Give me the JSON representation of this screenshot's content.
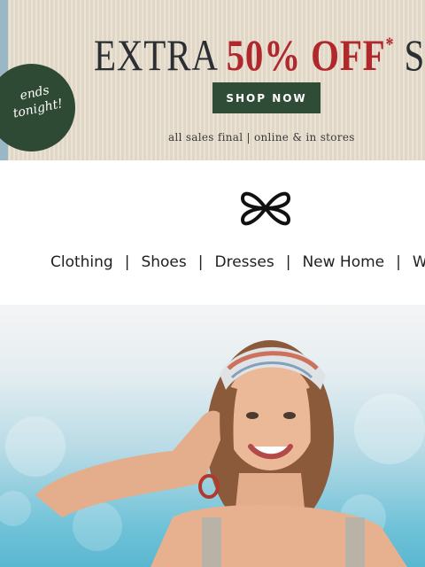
{
  "banner": {
    "headline_prefix": "EXTRA",
    "headline_percent": "50%",
    "headline_asterisk": "*",
    "headline_suffix": "OFF",
    "headline_asterisk2": "*",
    "headline_tail": "SALE",
    "button_label": "SHOP NOW",
    "fine_print": "all sales final | online & in stores",
    "badge_line1": "ends",
    "badge_line2": "tonight!",
    "colors": {
      "accent_red": "#b0272c",
      "forest_green": "#2f4c37"
    }
  },
  "header": {
    "logo_icon": "infinity-butterfly-logo-icon"
  },
  "nav": {
    "items": [
      {
        "label": "Clothing"
      },
      {
        "label": "Shoes"
      },
      {
        "label": "Dresses"
      },
      {
        "label": "New Home"
      },
      {
        "label": "We"
      }
    ],
    "separator": "|"
  },
  "hero": {
    "image_alt": "woman with headband smiling by the sea"
  }
}
